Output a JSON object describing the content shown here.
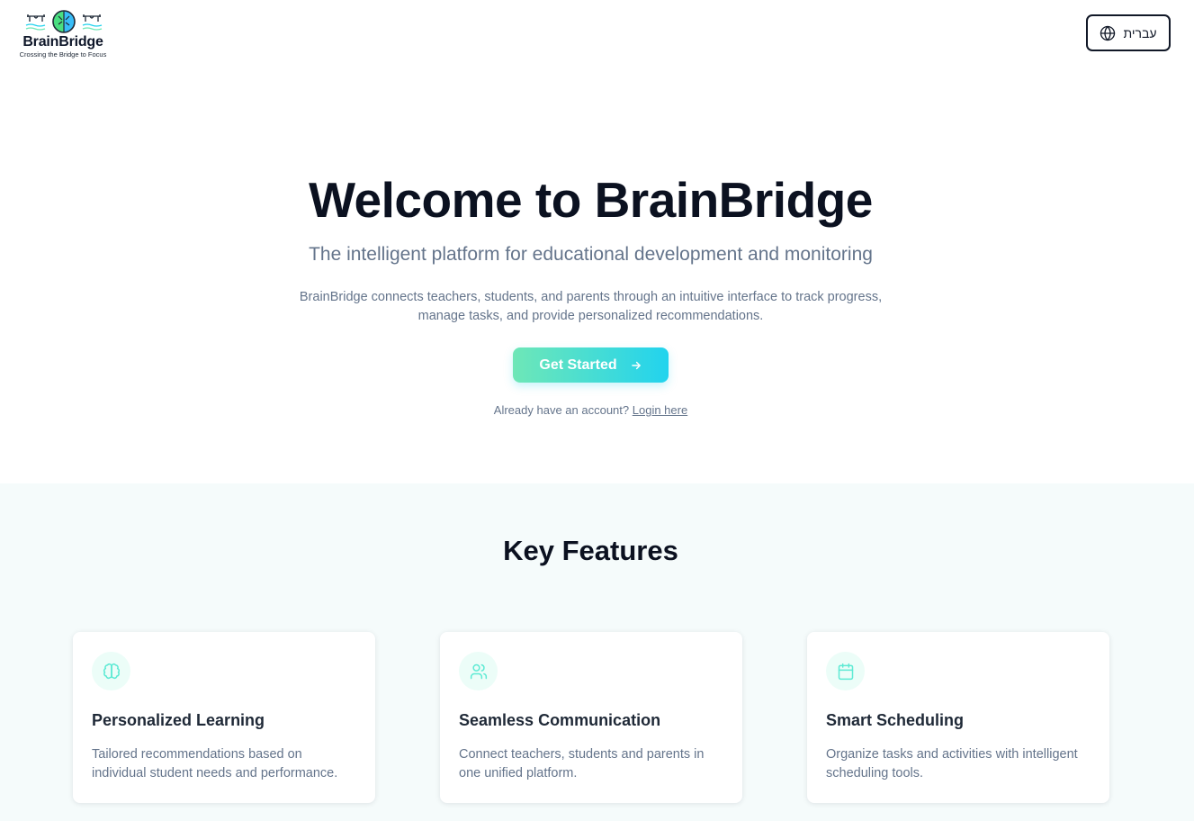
{
  "header": {
    "logo_name": "BrainBridge",
    "logo_tagline": "Crossing the Bridge to Focus",
    "language_button": {
      "label": "עברית",
      "icon": "globe-icon"
    }
  },
  "hero": {
    "title": "Welcome to BrainBridge",
    "subtitle": "The intelligent platform for educational development and monitoring",
    "description": "BrainBridge connects teachers, students, and parents through an intuitive interface to track progress, manage tasks, and provide personalized recommendations.",
    "cta_label": "Get Started",
    "login_prompt": "Already have an account?",
    "login_link": "Login here"
  },
  "features": {
    "title": "Key Features",
    "cards": [
      {
        "icon": "brain-icon",
        "title": "Personalized Learning",
        "text": "Tailored recommendations based on individual student needs and performance."
      },
      {
        "icon": "users-icon",
        "title": "Seamless Communication",
        "text": "Connect teachers, students and parents in one unified platform."
      },
      {
        "icon": "calendar-icon",
        "title": "Smart Scheduling",
        "text": "Organize tasks and activities with intelligent scheduling tools."
      }
    ]
  },
  "colors": {
    "accent_start": "#6ee7b7",
    "accent_end": "#22d3ee",
    "icon_color": "#5eead4",
    "section_bg": "#f5fbfb"
  }
}
